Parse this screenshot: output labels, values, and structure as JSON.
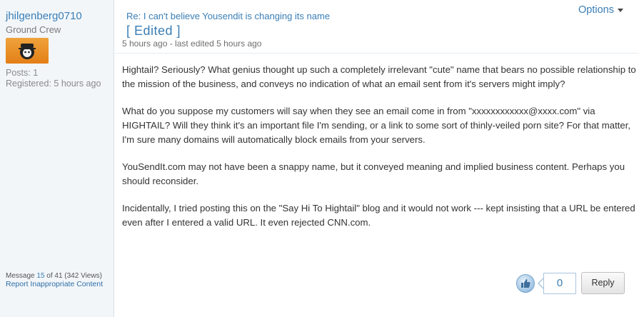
{
  "author": {
    "username": "jhilgenberg0710",
    "rank": "Ground Crew",
    "posts": "Posts: 1",
    "registered": "Registered: 5 hours ago"
  },
  "message_meta": {
    "prefix": "Message ",
    "number": "15",
    "of_text": " of 41",
    "views": " (342 Views)",
    "report_link": "Report Inappropriate Content"
  },
  "post": {
    "subject": "Re: I can't believe Yousendit is changing its name",
    "edited_label": "[ Edited ]",
    "timestamp": "5 hours ago - last edited 5 hours ago",
    "options_label": "Options",
    "paragraphs": [
      "Hightail?  Seriously?  What genius thought up such a completely irrelevant \"cute\" name that bears no possible relationship to the mission of the business, and conveys no indication of what an email sent from it's servers might imply?",
      "What do you suppose my customers will say when they see an email come in from \"xxxxxxxxxxxx@xxxx.com\" via HIGHTAIL?  Will they think it's an important file I'm sending, or a link to some sort of thinly-veiled porn site?  For that matter, I'm sure many domains will automatically block emails from your servers.",
      "YouSendIt.com may not have been a snappy name, but it conveyed meaning and implied business content.  Perhaps you should reconsider.",
      "Incidentally, I tried posting this on the \"Say Hi To Hightail\" blog and it would not work --- kept insisting that a URL be entered even after I entered a valid URL.  It even rejected CNN.com."
    ]
  },
  "actions": {
    "kudos_count": "0",
    "reply_label": "Reply"
  },
  "icons": {
    "kudos": "thumbs-up-icon",
    "options": "chevron-down-icon",
    "avatar": "avatar-image"
  },
  "colors": {
    "link": "#3a7eb5",
    "sidebar_bg": "#f2f6f9",
    "avatar_bg": "#e88b22"
  }
}
